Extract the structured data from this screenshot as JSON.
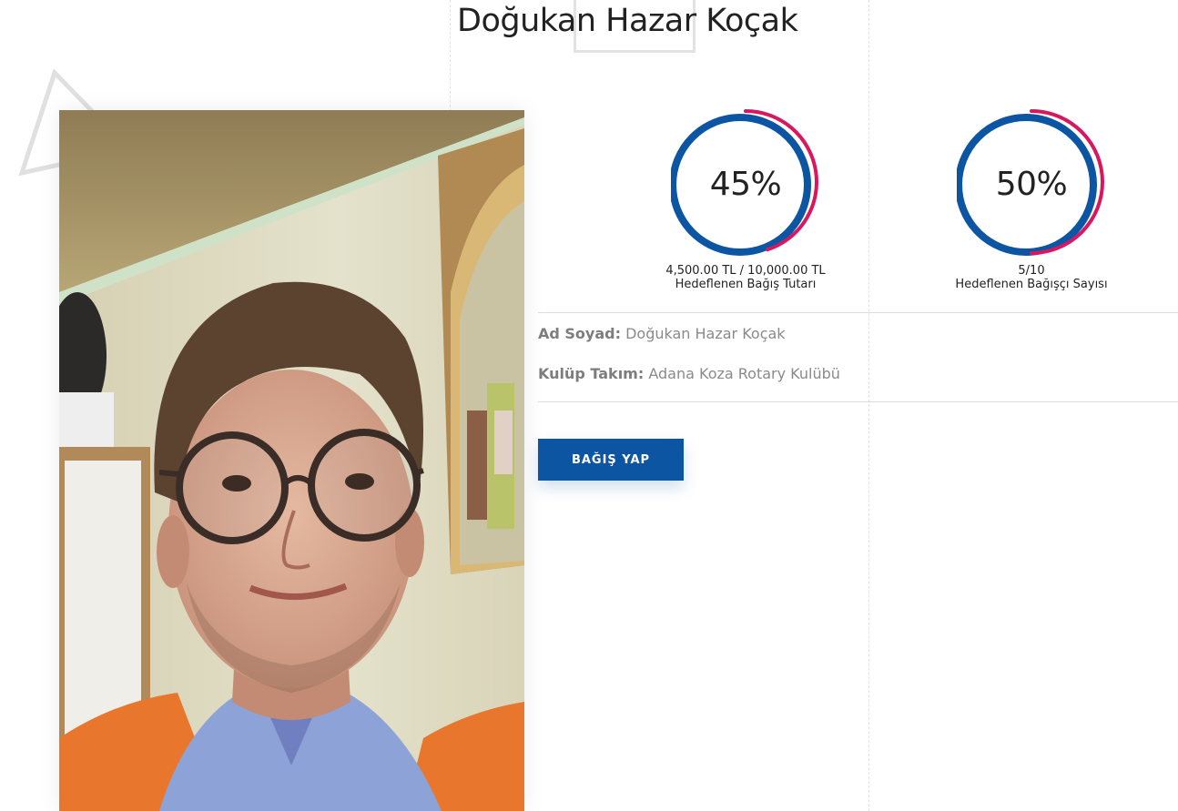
{
  "page": {
    "title": "Doğukan Hazar Koçak"
  },
  "colors": {
    "ring_blue": "#0b55a3",
    "ring_pink": "#d8175f",
    "button": "#0b55a3"
  },
  "photo": {
    "subject": "Doğukan Hazar Koçak"
  },
  "progress": [
    {
      "percent_label": "45%",
      "percent": 45,
      "amount": "4,500.00 TL / 10,000.00 TL",
      "caption": "Hedeflenen Bağış Tutarı"
    },
    {
      "percent_label": "50%",
      "percent": 50,
      "amount": "5/10",
      "caption": "Hedeflenen Bağışçı Sayısı"
    }
  ],
  "info": {
    "name_label": "Ad Soyad:",
    "name_value": "Doğukan Hazar Koçak",
    "club_label": "Kulüp Takım:",
    "club_value": "Adana Koza Rotary Kulübü"
  },
  "actions": {
    "donate_label": "BAĞIŞ YAP"
  }
}
